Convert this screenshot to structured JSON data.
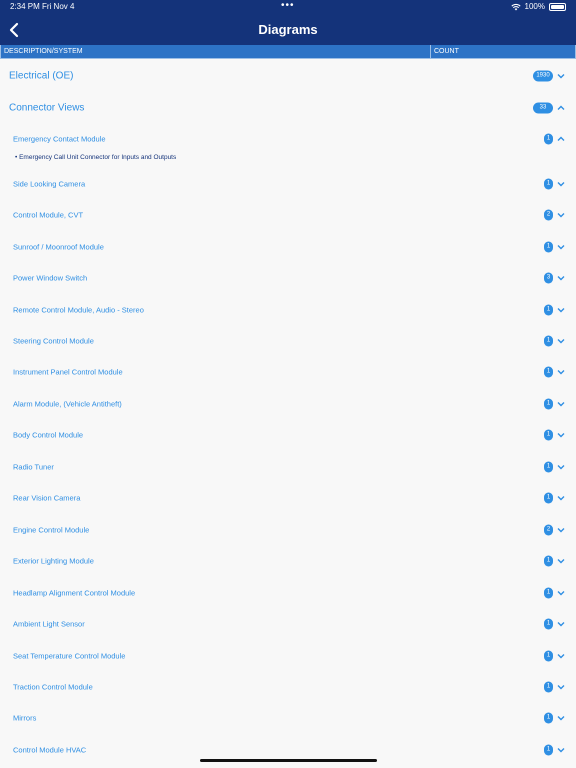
{
  "status_bar": {
    "time": "2:34 PM",
    "date": "Fri Nov 4",
    "dots": "•••",
    "battery": "100%"
  },
  "header": {
    "title": "Diagrams"
  },
  "columns": {
    "description": "DESCRIPTION/SYSTEM",
    "count": "COUNT"
  },
  "categories": [
    {
      "label": "Electrical (OE)",
      "count": "1930",
      "expanded": false
    },
    {
      "label": "Connector Views",
      "count": "33",
      "expanded": true
    }
  ],
  "subcategories": [
    {
      "label": "Emergency Contact Module",
      "count": "1",
      "expanded": true
    },
    {
      "label": "Side Looking Camera",
      "count": "1"
    },
    {
      "label": "Control Module, CVT",
      "count": "2"
    },
    {
      "label": "Sunroof / Moonroof Module",
      "count": "1"
    },
    {
      "label": "Power Window Switch",
      "count": "3"
    },
    {
      "label": "Remote Control Module, Audio - Stereo",
      "count": "1"
    },
    {
      "label": "Steering Control Module",
      "count": "1"
    },
    {
      "label": "Instrument Panel Control Module",
      "count": "1"
    },
    {
      "label": "Alarm Module, (Vehicle Antitheft)",
      "count": "1"
    },
    {
      "label": "Body Control Module",
      "count": "1"
    },
    {
      "label": "Radio Tuner",
      "count": "1"
    },
    {
      "label": "Rear Vision Camera",
      "count": "1"
    },
    {
      "label": "Engine Control Module",
      "count": "2"
    },
    {
      "label": "Exterior Lighting Module",
      "count": "1"
    },
    {
      "label": "Headlamp Alignment Control Module",
      "count": "1"
    },
    {
      "label": "Ambient Light Sensor",
      "count": "1"
    },
    {
      "label": "Seat Temperature Control Module",
      "count": "1"
    },
    {
      "label": "Traction Control Module",
      "count": "1"
    },
    {
      "label": "Mirrors",
      "count": "1"
    },
    {
      "label": "Control Module HVAC",
      "count": "1"
    }
  ],
  "detail_item": {
    "label": "• Emergency Call Unit Connector for Inputs and Outputs"
  },
  "colors": {
    "header": "#14337a",
    "column_bar": "#2d73c6",
    "accent": "#2f8fe3"
  }
}
